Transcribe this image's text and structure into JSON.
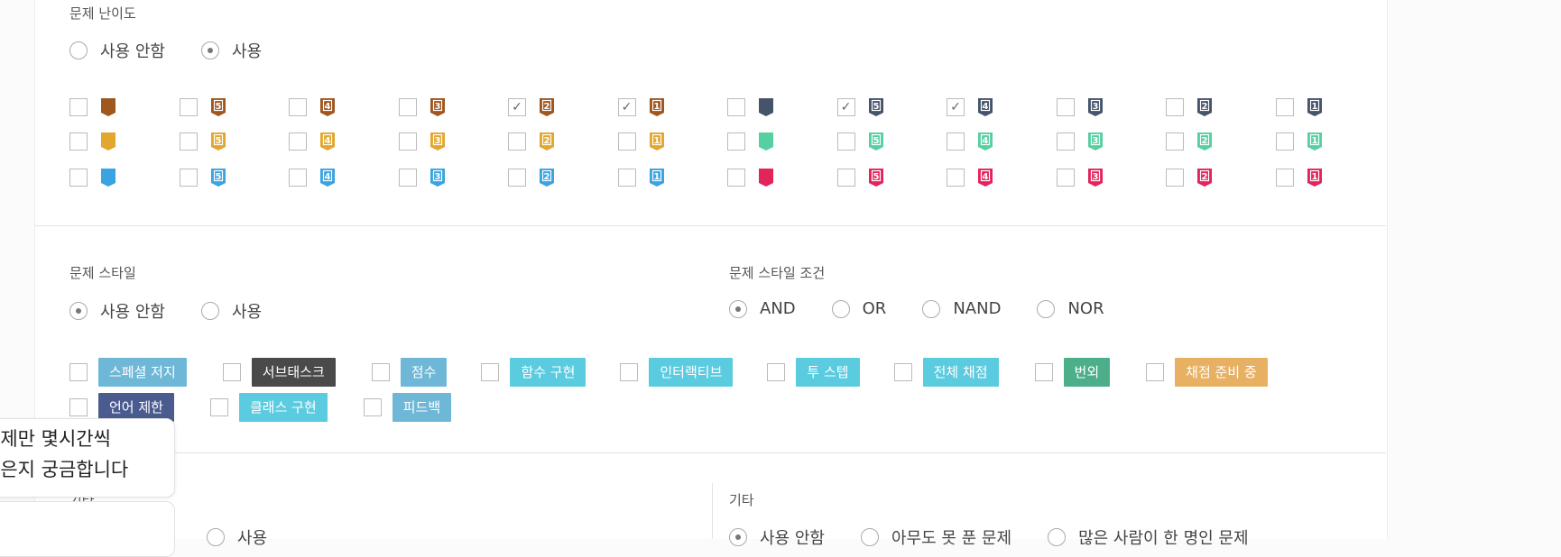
{
  "difficulty": {
    "title": "문제 난이도",
    "options": [
      {
        "label": "사용 안함",
        "selected": false
      },
      {
        "label": "사용",
        "selected": true
      }
    ],
    "tiers": [
      {
        "name": "bronze",
        "color": "#a0561f"
      },
      {
        "name": "gold",
        "color": "#e2a72e"
      },
      {
        "name": "sky",
        "color": "#3aa3e0"
      }
    ],
    "tiers_right": [
      {
        "name": "slate",
        "color": "#45536b"
      },
      {
        "name": "mint",
        "color": "#56d0a0"
      },
      {
        "name": "ruby",
        "color": "#e3245c"
      }
    ],
    "levels": [
      "",
      "5",
      "4",
      "3",
      "2",
      "1"
    ],
    "checked": [
      [
        false,
        false,
        false,
        false,
        true,
        true,
        false,
        true,
        true,
        false,
        false,
        false
      ],
      [
        false,
        false,
        false,
        false,
        false,
        false,
        false,
        false,
        false,
        false,
        false,
        false
      ],
      [
        false,
        false,
        false,
        false,
        false,
        false,
        false,
        false,
        false,
        false,
        false,
        false
      ]
    ]
  },
  "style": {
    "title": "문제 스타일",
    "options": [
      {
        "label": "사용 안함",
        "selected": true
      },
      {
        "label": "사용",
        "selected": false
      }
    ],
    "condition_title": "문제 스타일 조건",
    "conditions": [
      {
        "label": "AND",
        "selected": true
      },
      {
        "label": "OR",
        "selected": false
      },
      {
        "label": "NAND",
        "selected": false
      },
      {
        "label": "NOR",
        "selected": false
      }
    ],
    "tags_row1": [
      {
        "label": "스페셜 저지",
        "color": "#6fb7d6"
      },
      {
        "label": "서브태스크",
        "color": "#4a4a4a"
      },
      {
        "label": "점수",
        "color": "#6fb7d6"
      },
      {
        "label": "함수 구현",
        "color": "#5bcbe0"
      },
      {
        "label": "인터랙티브",
        "color": "#5bcbe0"
      },
      {
        "label": "투 스텝",
        "color": "#5bcbe0"
      },
      {
        "label": "전체 채점",
        "color": "#5bcbe0"
      },
      {
        "label": "번외",
        "color": "#4caf8a"
      },
      {
        "label": "채점 준비 중",
        "color": "#e8b062"
      }
    ],
    "tags_row2": [
      {
        "label": "언어 제한",
        "color": "#4a5b8f"
      },
      {
        "label": "클래스 구현",
        "color": "#5bcbe0"
      },
      {
        "label": "피드백",
        "color": "#6fb7d6"
      }
    ]
  },
  "etc": {
    "title_left": "기타",
    "left_option": "사용",
    "title_right": "기타",
    "right_options": [
      {
        "label": "사용 안함",
        "selected": true
      },
      {
        "label": "아무도 못 푼 문제",
        "selected": false
      },
      {
        "label": "많은 사람이 한 명인 문제",
        "selected": false
      }
    ]
  },
  "bubble": {
    "line1": "문제만 몇시간씩",
    "line2": "좋은지 궁금합니다"
  }
}
